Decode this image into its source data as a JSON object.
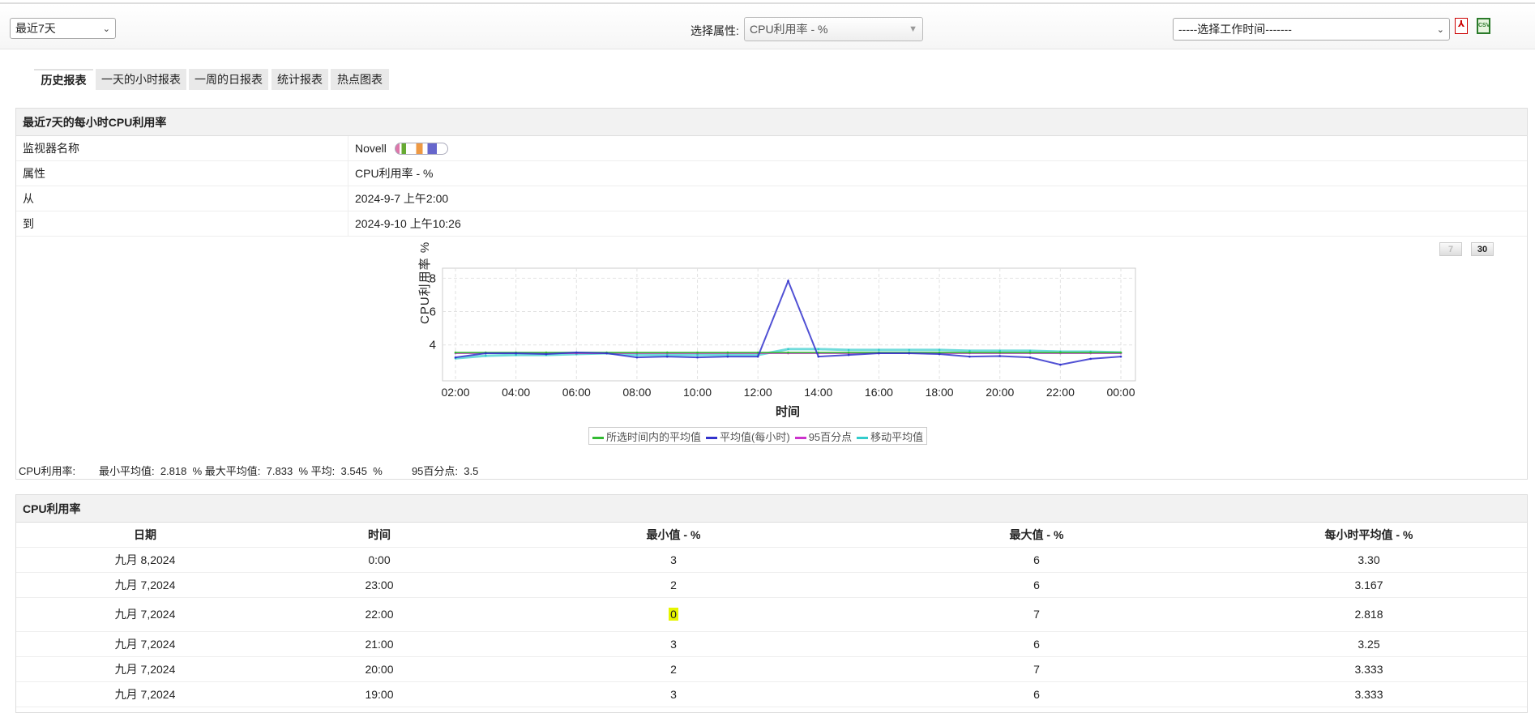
{
  "toolbar": {
    "period": "最近7天",
    "attr_label": "选择属性:",
    "attr_value": "CPU利用率 - %",
    "worktime": "-----选择工作时间-------"
  },
  "tabs": [
    "历史报表",
    "一天的小时报表",
    "一周的日报表",
    "统计报表",
    "热点图表"
  ],
  "info": {
    "title": "最近7天的每小时CPU利用率",
    "rows": [
      {
        "k": "监视器名称",
        "v": "Novell"
      },
      {
        "k": "属性",
        "v": "CPU利用率 - %"
      },
      {
        "k": "从",
        "v": "2024-9-7 上午2:00"
      },
      {
        "k": "到",
        "v": "2024-9-10 上午10:26"
      }
    ],
    "btn7": "7",
    "btn30": "30"
  },
  "stats": {
    "label": "CPU利用率:",
    "min_label": "最小平均值:",
    "min": "2.818",
    "max_label": "最大平均值:",
    "max": "7.833",
    "avg_label": "平均:",
    "avg": "3.545",
    "unit": "%",
    "p95_label": "95百分点:",
    "p95": "3.5"
  },
  "chart_data": {
    "type": "line",
    "xlabel": "时间",
    "ylabel": "CPU利用率 %",
    "ylim": [
      1.85,
      8.6
    ],
    "yticks": [
      4,
      6,
      8
    ],
    "x": [
      "02:00",
      "03:00",
      "04:00",
      "05:00",
      "06:00",
      "07:00",
      "08:00",
      "09:00",
      "10:00",
      "11:00",
      "12:00",
      "13:00",
      "14:00",
      "15:00",
      "16:00",
      "17:00",
      "18:00",
      "19:00",
      "20:00",
      "21:00",
      "22:00",
      "23:00",
      "00:00"
    ],
    "xticks": [
      "02:00",
      "04:00",
      "06:00",
      "08:00",
      "10:00",
      "12:00",
      "14:00",
      "16:00",
      "18:00",
      "20:00",
      "22:00",
      "00:00"
    ],
    "series": [
      {
        "name": "所选时间内的平均值",
        "color": "#33bb33",
        "values": [
          3.545,
          3.545,
          3.545,
          3.545,
          3.545,
          3.545,
          3.545,
          3.545,
          3.545,
          3.545,
          3.545,
          3.545,
          3.545,
          3.545,
          3.545,
          3.545,
          3.545,
          3.545,
          3.545,
          3.545,
          3.545,
          3.545,
          3.545
        ]
      },
      {
        "name": "平均值(每小时)",
        "color": "#3333cc",
        "values": [
          3.25,
          3.5,
          3.5,
          3.45,
          3.55,
          3.5,
          3.25,
          3.3,
          3.25,
          3.3,
          3.3,
          7.833,
          3.3,
          3.4,
          3.5,
          3.5,
          3.45,
          3.3,
          3.333,
          3.25,
          2.818,
          3.167,
          3.3
        ]
      },
      {
        "name": "95百分点",
        "color": "#cc33cc",
        "values": [
          3.5,
          3.5,
          3.5,
          3.5,
          3.5,
          3.5,
          3.5,
          3.5,
          3.5,
          3.5,
          3.5,
          3.5,
          3.5,
          3.5,
          3.5,
          3.5,
          3.5,
          3.5,
          3.5,
          3.5,
          3.5,
          3.5,
          3.5
        ]
      },
      {
        "name": "移动平均值",
        "color": "#33cccc",
        "values": [
          3.2,
          3.35,
          3.4,
          3.4,
          3.45,
          3.5,
          3.4,
          3.4,
          3.4,
          3.4,
          3.4,
          3.75,
          3.75,
          3.7,
          3.7,
          3.7,
          3.7,
          3.65,
          3.65,
          3.65,
          3.6,
          3.6,
          3.55
        ]
      }
    ]
  },
  "table": {
    "title": "CPU利用率",
    "headers": [
      "日期",
      "时间",
      "最小值 - %",
      "最大值 - %",
      "每小时平均值 - %"
    ],
    "rows": [
      [
        "九月 8,2024",
        "0:00",
        "3",
        "6",
        "3.30"
      ],
      [
        "九月 7,2024",
        "23:00",
        "2",
        "6",
        "3.167"
      ],
      [
        "九月 7,2024",
        "22:00",
        "0",
        "7",
        "2.818"
      ],
      [
        "九月 7,2024",
        "21:00",
        "3",
        "6",
        "3.25"
      ],
      [
        "九月 7,2024",
        "20:00",
        "2",
        "7",
        "3.333"
      ],
      [
        "九月 7,2024",
        "19:00",
        "3",
        "6",
        "3.333"
      ]
    ]
  }
}
